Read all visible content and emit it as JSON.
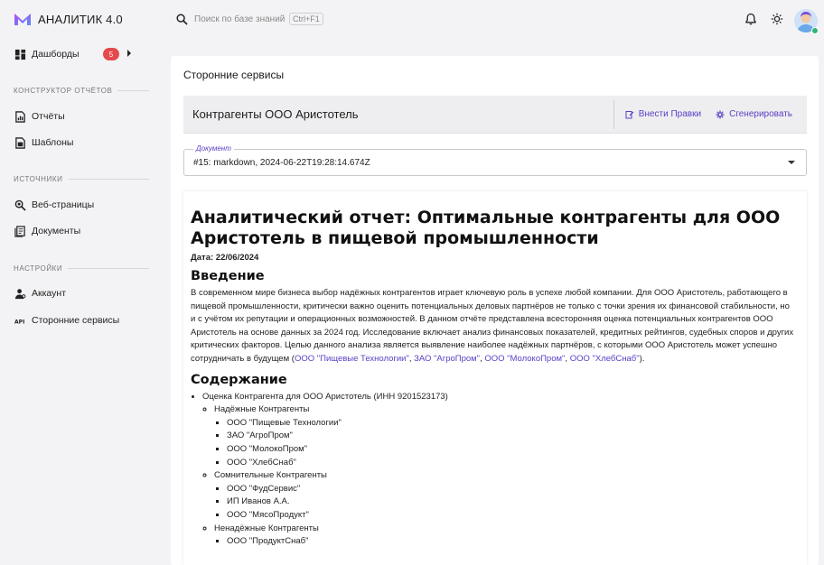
{
  "app": {
    "name": "АНАЛИТИК 4.0",
    "brand_color": "#8b5cf6"
  },
  "sidebar": {
    "dashboards": {
      "label": "Дашборды",
      "badge": "5"
    },
    "sections": {
      "builder": "КОНСТРУКТОР ОТЧЁТОВ",
      "sources": "ИСТОЧНИКИ",
      "settings": "НАСТРОЙКИ"
    },
    "items": {
      "reports": "Отчёты",
      "templates": "Шаблоны",
      "webpages": "Веб-страницы",
      "documents": "Документы",
      "account": "Аккаунт",
      "services": "Сторонние сервисы"
    },
    "icons": {
      "dashboards": "dashboard-grid-icon",
      "reports": "report-icon",
      "templates": "template-icon",
      "webpages": "web-search-icon",
      "documents": "document-icon",
      "account": "account-icon",
      "services": "api-icon"
    }
  },
  "topbar": {
    "search_placeholder": "Поиск по базе знаний",
    "shortcut": "Ctrl+F1"
  },
  "main": {
    "title": "Сторонние сервисы",
    "header_title": "Контрагенты ООО Аристотель",
    "edit_label": "Внести Правки",
    "generate_label": "Сгенерировать",
    "select_legend": "Документ",
    "select_value": "#15: markdown, 2024-06-22T19:28:14.674Z"
  },
  "document": {
    "h1": "Аналитический отчет: Оптимальные контрагенты для ООО Аристотель в пищевой промышленности",
    "date": "Дата: 22/06/2024",
    "intro_heading": "Введение",
    "intro_text": "В современном мире бизнеса выбор надёжных контрагентов играет ключевую роль в успехе любой компании. Для ООО Аристотель, работающего в пищевой промышленности, критически важно оценить потенциальных деловых партнёров не только с точки зрения их финансовой стабильности, но и с учётом их репутации и операционных возможностей. В данном отчёте представлена всесторонняя оценка потенциальных контрагентов ООО Аристотель на основе данных за 2024 год. Исследование включает анализ финансовых показателей, кредитных рейтингов, судебных споров и других критических факторов. Целью данного анализа является выявление наиболее надёжных партнёров, с которыми ООО Аристотель может успешно сотрудничать в будущем (",
    "intro_links": [
      "ООО \"Пищевые Технологии\"",
      "ЗАО \"АгроПром\"",
      "ООО \"МолокоПром\"",
      "ООО \"ХлебСнаб\""
    ],
    "intro_end": ").",
    "toc_heading": "Содержание",
    "toc_root": "Оценка Контрагента для ООО Аристотель (ИНН 9201523173)",
    "groups": [
      {
        "label": "Надёжные Контрагенты",
        "items": [
          "ООО \"Пищевые Технологии\"",
          "ЗАО \"АгроПром\"",
          "ООО \"МолокоПром\"",
          "ООО \"ХлебСнаб\""
        ]
      },
      {
        "label": "Сомнительные Контрагенты",
        "items": [
          "ООО \"ФудСервис\"",
          "ИП Иванов А.А.",
          "ООО \"МясоПродукт\""
        ]
      },
      {
        "label": "Ненадёжные Контрагенты",
        "items": [
          "ООО \"ПродуктСнаб\""
        ]
      }
    ]
  }
}
